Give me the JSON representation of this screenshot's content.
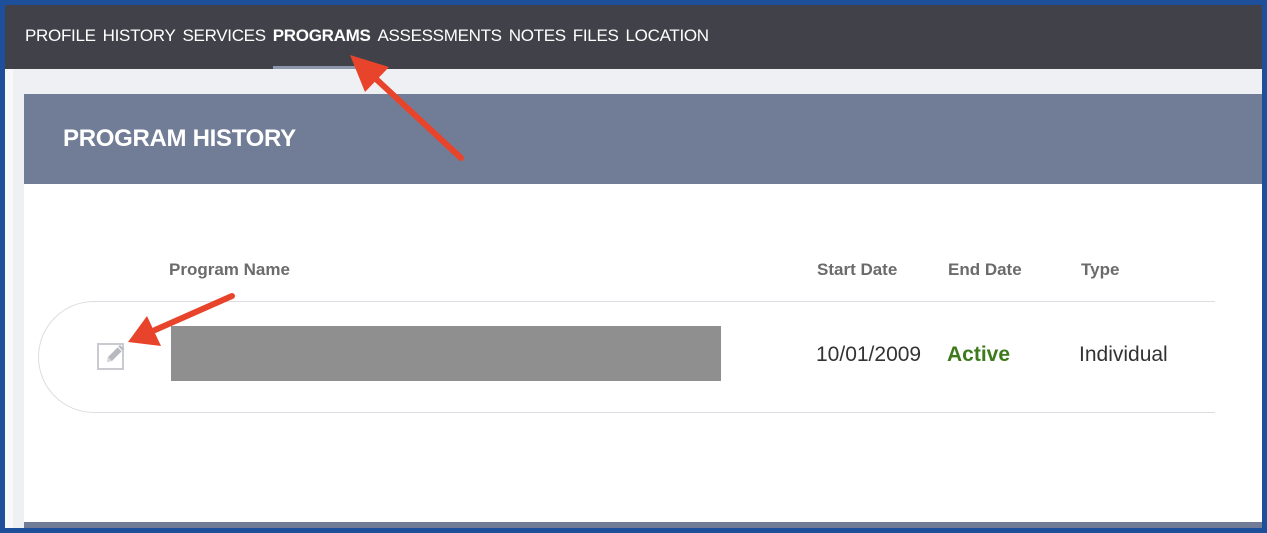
{
  "tabs": [
    {
      "label": "PROFILE"
    },
    {
      "label": "HISTORY"
    },
    {
      "label": "SERVICES"
    },
    {
      "label": "PROGRAMS"
    },
    {
      "label": "ASSESSMENTS"
    },
    {
      "label": "NOTES"
    },
    {
      "label": "FILES"
    },
    {
      "label": "LOCATION"
    }
  ],
  "active_tab": "PROGRAMS",
  "panel": {
    "title": "PROGRAM HISTORY",
    "columns": {
      "program_name": "Program Name",
      "start_date": "Start Date",
      "end_date": "End Date",
      "type": "Type"
    },
    "rows": [
      {
        "program_name": "",
        "start_date": "10/01/2009",
        "end_date": "Active",
        "type": "Individual",
        "edit_icon": "pencil-edit-icon"
      }
    ]
  },
  "colors": {
    "window_border": "#1d4f9a",
    "tab_bar": "#414249",
    "panel_header": "#717d97",
    "status_active": "#3d7a1c",
    "annotation_arrow": "#e8442b",
    "redaction": "#8f8f8f"
  }
}
